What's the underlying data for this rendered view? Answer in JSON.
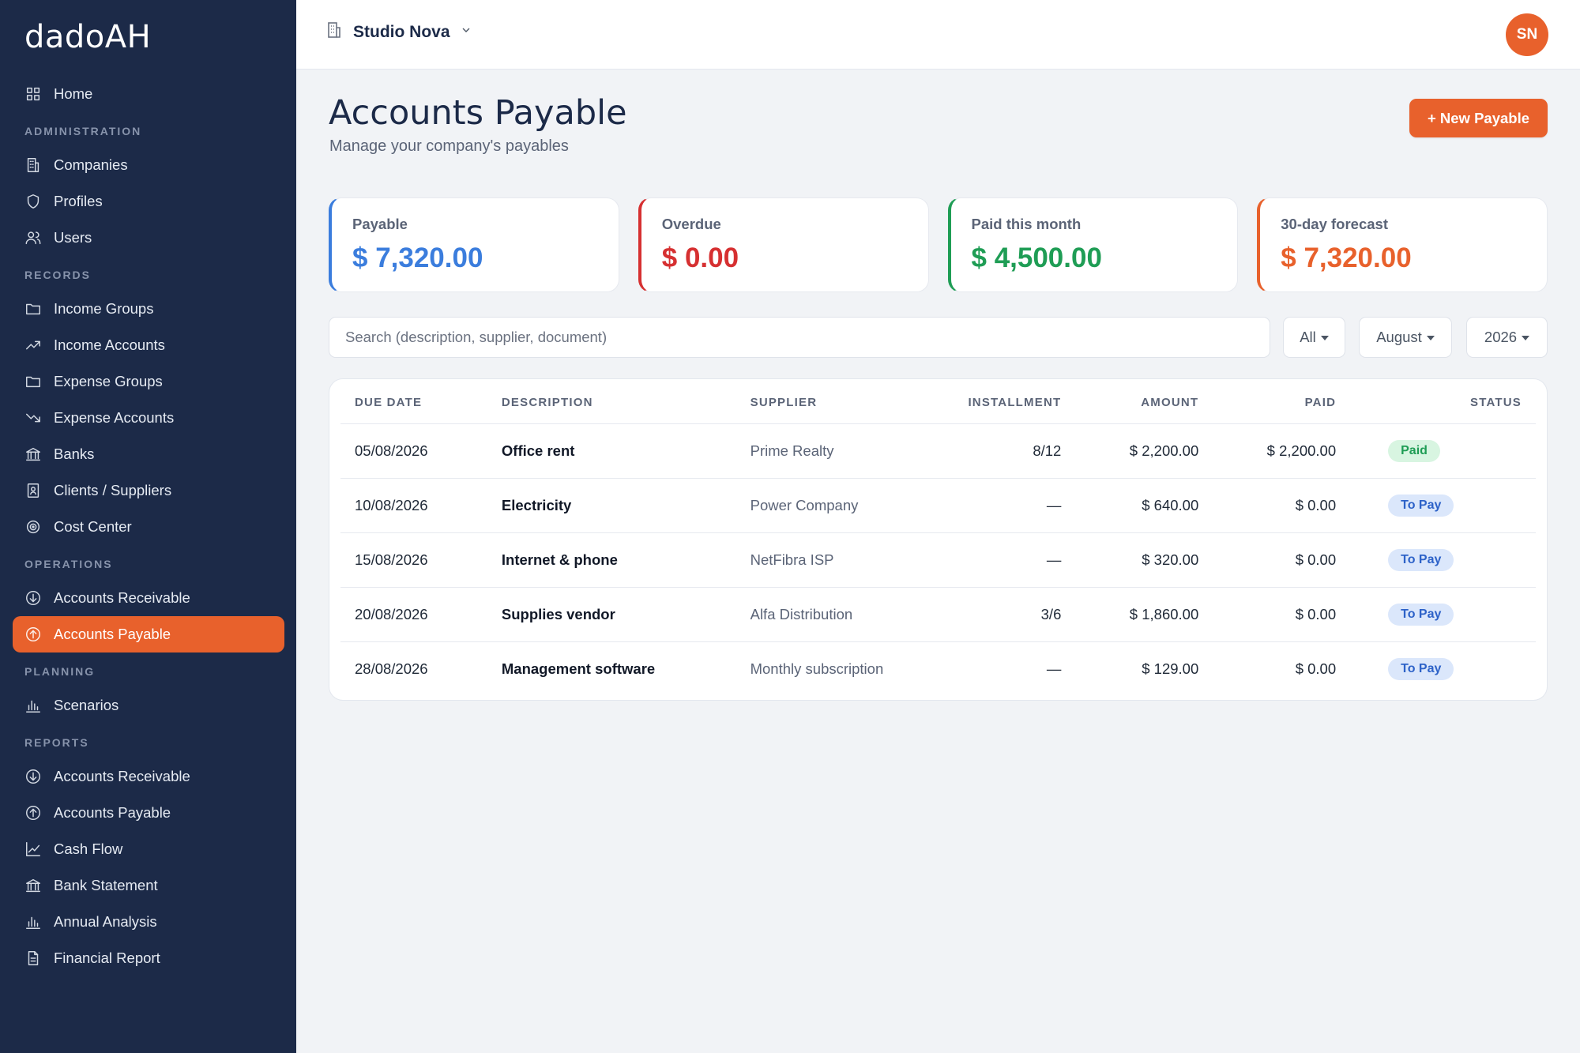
{
  "app": {
    "logo": "dadoAH"
  },
  "sidebar": {
    "home": "Home",
    "sections": {
      "administration": "ADMINISTRATION",
      "records": "RECORDS",
      "operations": "OPERATIONS",
      "planning": "PLANNING",
      "reports": "REPORTS"
    },
    "administration": [
      "Companies",
      "Profiles",
      "Users"
    ],
    "records": [
      "Income Groups",
      "Income Accounts",
      "Expense Groups",
      "Expense Accounts",
      "Banks",
      "Clients / Suppliers",
      "Cost Center"
    ],
    "operations": [
      "Accounts Receivable",
      "Accounts Payable"
    ],
    "planning": [
      "Scenarios"
    ],
    "reports": [
      "Accounts Receivable",
      "Accounts Payable",
      "Cash Flow",
      "Bank Statement",
      "Annual Analysis",
      "Financial Report"
    ],
    "active_item": "Accounts Payable",
    "accent_color": "#e8612c"
  },
  "topbar": {
    "company": "Studio Nova",
    "avatar_initials": "SN"
  },
  "page": {
    "title": "Accounts Payable",
    "subtitle": "Manage your company's payables",
    "new_button": "+ New Payable"
  },
  "cards": [
    {
      "label": "Payable",
      "value": "$ 7,320.00",
      "color": "#3b7ddd"
    },
    {
      "label": "Overdue",
      "value": "$ 0.00",
      "color": "#d63031"
    },
    {
      "label": "Paid this month",
      "value": "$ 4,500.00",
      "color": "#1f9d55"
    },
    {
      "label": "30-day forecast",
      "value": "$ 7,320.00",
      "color": "#e8612c"
    }
  ],
  "filters": {
    "search_placeholder": "Search (description, supplier, document)",
    "status": "All",
    "month": "August",
    "year": "2026"
  },
  "table": {
    "headers": [
      "DUE DATE",
      "DESCRIPTION",
      "SUPPLIER",
      "INSTALLMENT",
      "AMOUNT",
      "PAID",
      "STATUS"
    ],
    "rows": [
      {
        "due": "05/08/2026",
        "desc": "Office rent",
        "supplier": "Prime Realty",
        "installment": "8/12",
        "amount": "$ 2,200.00",
        "paid": "$ 2,200.00",
        "status": "Paid"
      },
      {
        "due": "10/08/2026",
        "desc": "Electricity",
        "supplier": "Power Company",
        "installment": "—",
        "amount": "$ 640.00",
        "paid": "$ 0.00",
        "status": "To Pay"
      },
      {
        "due": "15/08/2026",
        "desc": "Internet & phone",
        "supplier": "NetFibra ISP",
        "installment": "—",
        "amount": "$ 320.00",
        "paid": "$ 0.00",
        "status": "To Pay"
      },
      {
        "due": "20/08/2026",
        "desc": "Supplies vendor",
        "supplier": "Alfa Distribution",
        "installment": "3/6",
        "amount": "$ 1,860.00",
        "paid": "$ 0.00",
        "status": "To Pay"
      },
      {
        "due": "28/08/2026",
        "desc": "Management software",
        "supplier": "Monthly subscription",
        "installment": "—",
        "amount": "$ 129.00",
        "paid": "$ 0.00",
        "status": "To Pay"
      }
    ]
  }
}
